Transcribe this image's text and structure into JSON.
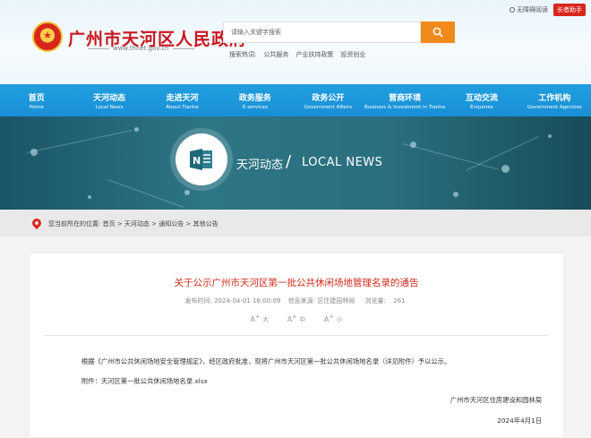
{
  "util": {
    "accessibility": "无障碍阅读",
    "elder": "长者助手"
  },
  "site": {
    "title": "广州市天河区人民政府",
    "url": "www.thnet.gov.cn"
  },
  "search": {
    "placeholder": "请输入关键字搜索"
  },
  "hot": {
    "label": "搜索热词:",
    "items": [
      "公共服务",
      "产业扶持政策",
      "投资创业"
    ]
  },
  "nav": [
    {
      "zh": "首页",
      "en": "Home"
    },
    {
      "zh": "天河动态",
      "en": "Local News"
    },
    {
      "zh": "走进天河",
      "en": "About Tianhe"
    },
    {
      "zh": "政务服务",
      "en": "E-services"
    },
    {
      "zh": "政务公开",
      "en": "Government Affairs"
    },
    {
      "zh": "营商环境",
      "en": "Business & Investment in Tianhe"
    },
    {
      "zh": "互动交流",
      "en": "Enquiries"
    },
    {
      "zh": "工作机构",
      "en": "Government Agencies"
    }
  ],
  "banner": {
    "zh": "天河动态",
    "slash": "/",
    "en": "LOCAL NEWS",
    "icon": "news-app-icon"
  },
  "breadcrumb": {
    "prefix": "您当前所在的位置:",
    "items": [
      "首页",
      "天河动态",
      "通知公告",
      "其他公告"
    ],
    "separator": " > "
  },
  "article": {
    "title": "关于公示广州市天河区第一批公共休闲场地管理名录的通告",
    "publish_time": "发布时间:  2024-04-01 16:00:09",
    "source": "信息来源:  区住建园林局",
    "views_label": "浏览量:",
    "views": "261",
    "font_large": "大",
    "font_medium": "中",
    "font_small": "小",
    "body1": "根据《广州市公共休闲场地安全管理规定》，经区政府批准，现将广州市天河区第一批公共休闲场地名录（详见附件）予以公示。",
    "body2": "附件：天河区第一批公共休闲场地名录.xlsx",
    "signer": "广州市天河区住房建设和园林局",
    "date": "2024年4月1日"
  },
  "colors": {
    "nav": "#1a8fd6",
    "title": "#d22a1c",
    "search_button": "#f08a1c",
    "elder_badge": "#d9261c"
  }
}
